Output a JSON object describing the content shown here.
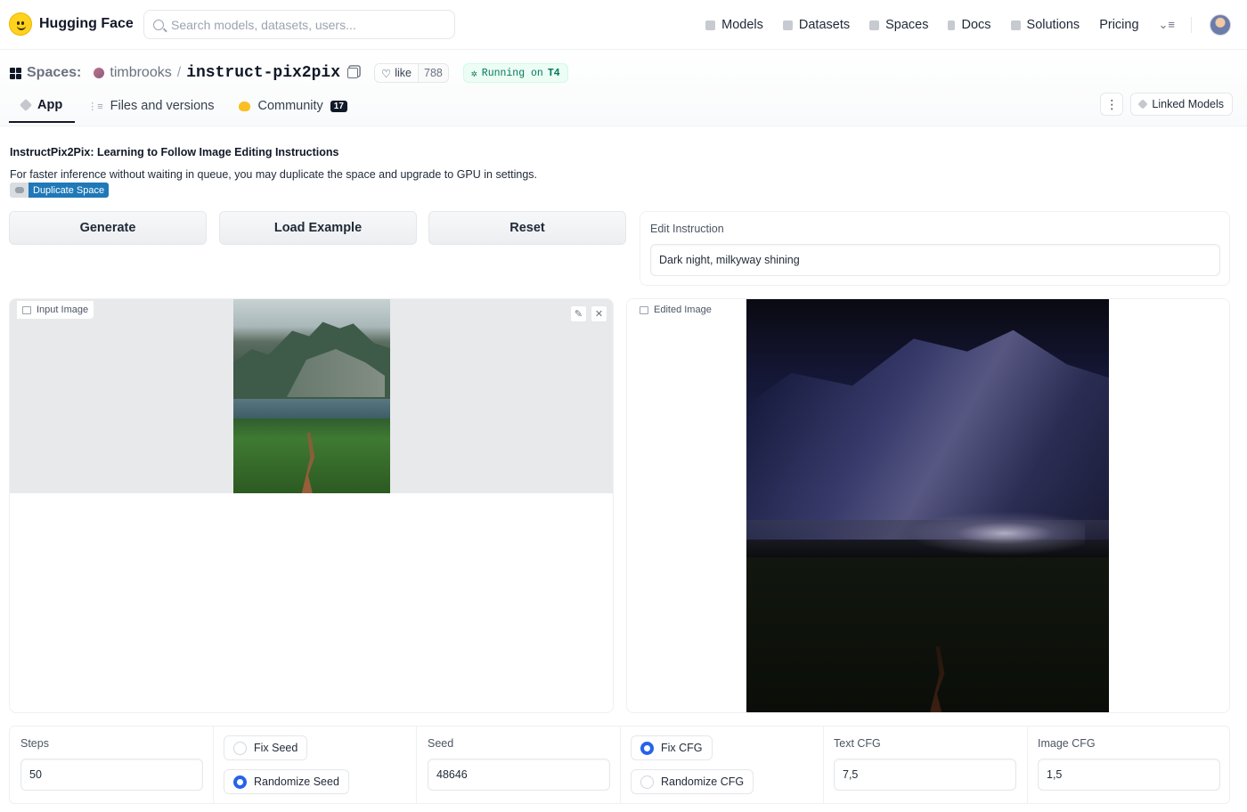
{
  "nav": {
    "brand": "Hugging Face",
    "search_placeholder": "Search models, datasets, users...",
    "links": [
      "Models",
      "Datasets",
      "Spaces",
      "Docs",
      "Solutions",
      "Pricing"
    ]
  },
  "space": {
    "section_label": "Spaces:",
    "owner": "timbrooks",
    "separator": "/",
    "repo": "instruct-pix2pix",
    "like_label": "like",
    "like_count": "788",
    "status_prefix": "Running on",
    "status_hardware": "T4",
    "tabs": [
      {
        "label": "App",
        "active": true
      },
      {
        "label": "Files and versions",
        "active": false
      },
      {
        "label": "Community",
        "active": false,
        "badge": "17"
      }
    ],
    "linked_models_label": "Linked Models"
  },
  "app": {
    "title": "InstructPix2Pix: Learning to Follow Image Editing Instructions",
    "description": "For faster inference without waiting in queue, you may duplicate the space and upgrade to GPU in settings.",
    "duplicate_label": "Duplicate Space",
    "buttons": {
      "generate": "Generate",
      "load_example": "Load Example",
      "reset": "Reset"
    },
    "edit_instruction": {
      "label": "Edit Instruction",
      "value": "Dark night, milkyway shining"
    },
    "input_image_label": "Input Image",
    "edited_image_label": "Edited Image",
    "steps": {
      "label": "Steps",
      "value": "50"
    },
    "seed_mode": {
      "options": [
        "Fix Seed",
        "Randomize Seed"
      ],
      "selected": "Randomize Seed"
    },
    "seed": {
      "label": "Seed",
      "value": "48646"
    },
    "cfg_mode": {
      "options": [
        "Fix CFG",
        "Randomize CFG"
      ],
      "selected": "Fix CFG"
    },
    "text_cfg": {
      "label": "Text CFG",
      "value": "7,5"
    },
    "image_cfg": {
      "label": "Image CFG",
      "value": "1,5"
    }
  },
  "colors": {
    "accent": "#2563eb",
    "status_green": "#047857",
    "badge_blue": "#1f78b7"
  }
}
